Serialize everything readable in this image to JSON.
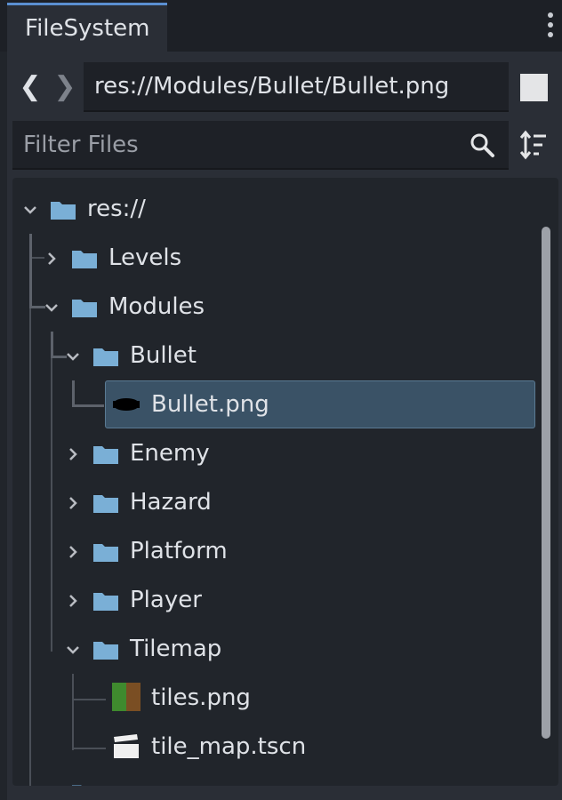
{
  "dock": {
    "tab_label": "FileSystem",
    "menu_icon": "vertical-dots-icon"
  },
  "navigation": {
    "back_icon": "chevron-left-icon",
    "forward_icon": "chevron-right-icon",
    "path": "res://Modules/Bullet/Bullet.png",
    "toggle_icon": "square-icon"
  },
  "filter": {
    "placeholder": "Filter Files",
    "search_icon": "search-icon",
    "sort_icon": "sort-icon"
  },
  "tree": {
    "items": [
      {
        "label": "res://",
        "type": "folder",
        "expanded": true
      },
      {
        "label": "Levels",
        "type": "folder",
        "expanded": false
      },
      {
        "label": "Modules",
        "type": "folder",
        "expanded": true
      },
      {
        "label": "Bullet",
        "type": "folder",
        "expanded": true
      },
      {
        "label": "Bullet.png",
        "type": "image",
        "selected": true
      },
      {
        "label": "Enemy",
        "type": "folder",
        "expanded": false
      },
      {
        "label": "Hazard",
        "type": "folder",
        "expanded": false
      },
      {
        "label": "Platform",
        "type": "folder",
        "expanded": false
      },
      {
        "label": "Player",
        "type": "folder",
        "expanded": false
      },
      {
        "label": "Tilemap",
        "type": "folder",
        "expanded": true
      },
      {
        "label": "tiles.png",
        "type": "image"
      },
      {
        "label": "tile_map.tscn",
        "type": "scene"
      }
    ]
  },
  "colors": {
    "folder": "#7aafd6",
    "selection": "#3a5266",
    "tab_accent": "#5b8fd1"
  }
}
